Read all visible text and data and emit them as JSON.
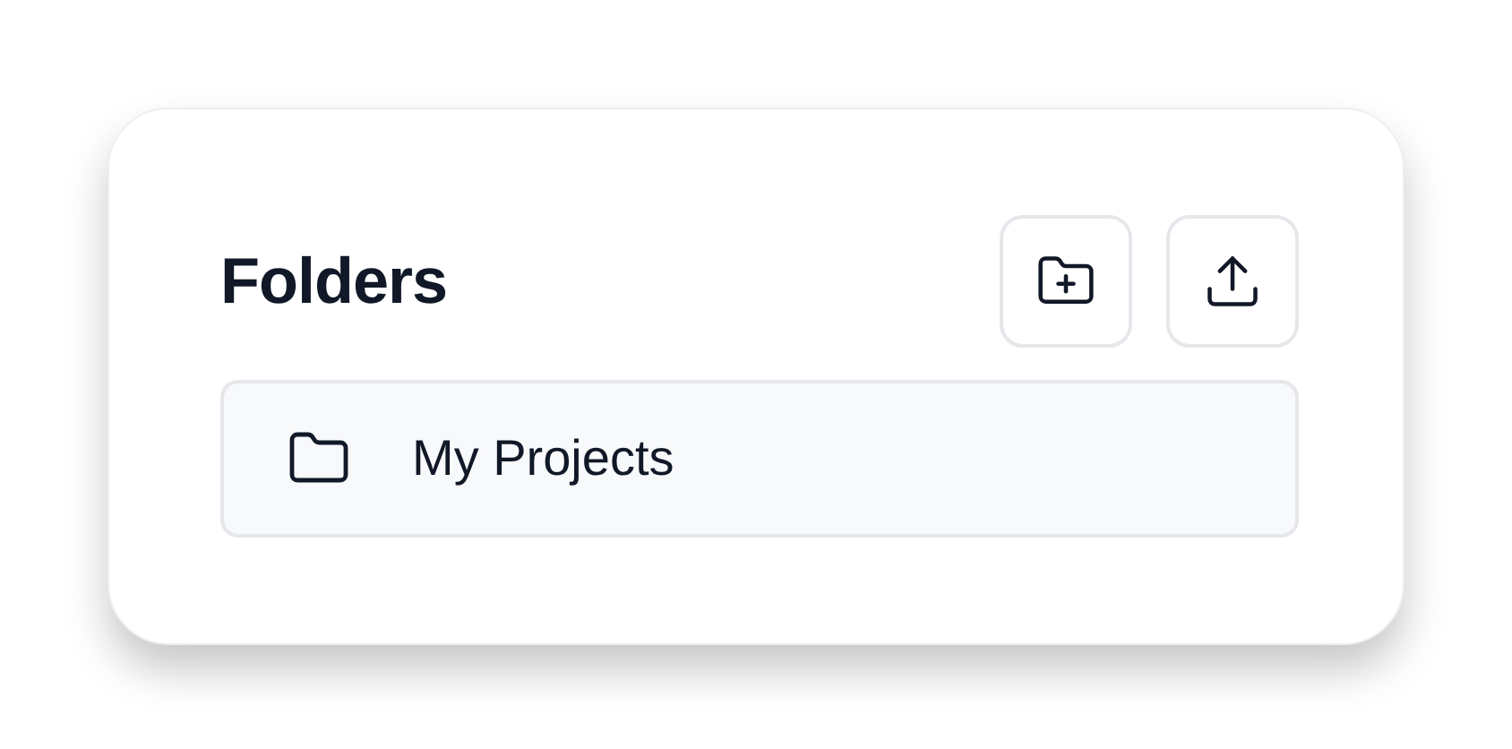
{
  "title": "Folders",
  "folders": [
    {
      "name": "My Projects"
    }
  ]
}
